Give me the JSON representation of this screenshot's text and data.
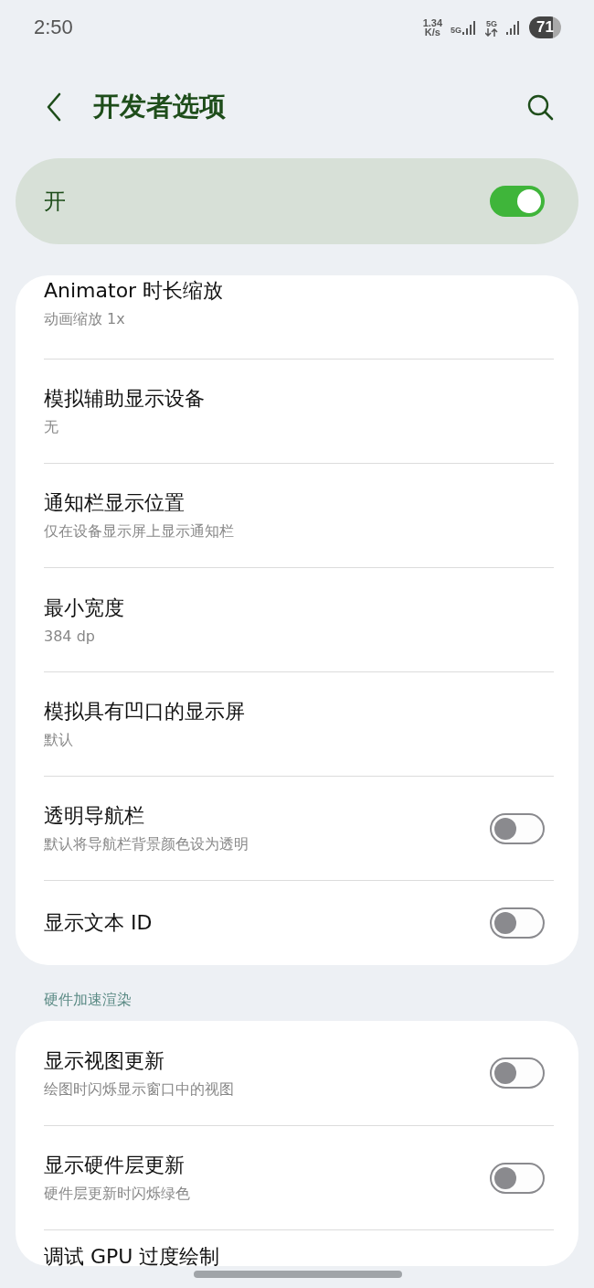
{
  "status_bar": {
    "time": "2:50",
    "net_speed": "1.34",
    "net_unit": "K/s",
    "sim1": "5G",
    "sim2": "5G",
    "battery": "71"
  },
  "header": {
    "title": "开发者选项"
  },
  "master": {
    "label": "开",
    "on": true
  },
  "groups": [
    {
      "items": [
        {
          "kind": "value",
          "title": "Animator 时长缩放",
          "subtitle": "动画缩放 1x"
        },
        {
          "kind": "value",
          "title": "模拟辅助显示设备",
          "subtitle": "无"
        },
        {
          "kind": "value",
          "title": "通知栏显示位置",
          "subtitle": "仅在设备显示屏上显示通知栏"
        },
        {
          "kind": "value",
          "title": "最小宽度",
          "subtitle": "384 dp"
        },
        {
          "kind": "value",
          "title": "模拟具有凹口的显示屏",
          "subtitle": "默认"
        },
        {
          "kind": "toggle",
          "title": "透明导航栏",
          "subtitle": "默认将导航栏背景颜色设为透明",
          "on": false
        },
        {
          "kind": "toggle",
          "title": "显示文本 ID",
          "on": false
        }
      ]
    },
    {
      "header": "硬件加速渲染",
      "items": [
        {
          "kind": "toggle",
          "title": "显示视图更新",
          "subtitle": "绘图时闪烁显示窗口中的视图",
          "on": false
        },
        {
          "kind": "toggle",
          "title": "显示硬件层更新",
          "subtitle": "硬件层更新时闪烁绿色",
          "on": false
        },
        {
          "kind": "value",
          "title": "调试 GPU 过度绘制"
        }
      ]
    }
  ]
}
